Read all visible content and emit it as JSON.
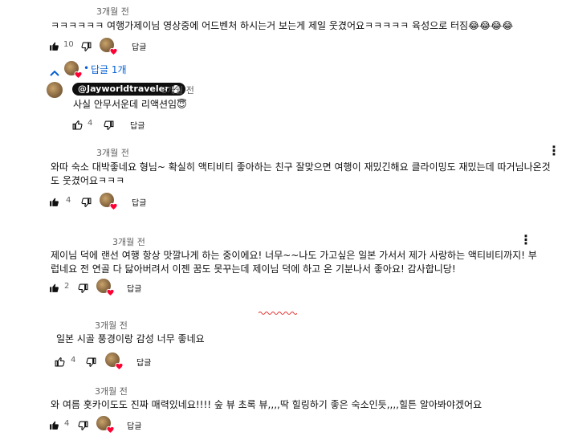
{
  "comments": [
    {
      "time": "3개월 전",
      "text": "ㅋㅋㅋㅋㅋㅋ 여행가제이님 영상중에 어드벤처 하시는거 보는게 제일 웃겼어요ㅋㅋㅋㅋㅋ 육성으로 터짐😂😂😂😂",
      "likes": "10",
      "reply_label": "답글"
    },
    {
      "time": "3개월 전",
      "text": "와따 숙소 대박좋네요 형님~ 확실히 액티비티 좋아하는 친구 잘맞으면 여행이 재밌긴해요 클라이밍도 재밌는데 따거님나온것도 웃겼어요ㅋㅋㅋ",
      "likes": "4",
      "reply_label": "답글"
    },
    {
      "time": "3개월 전",
      "text": "제이님 덕에 랜선 여행 항상 맛깔나게 하는 중이에요! 너무~~나도 가고싶은 일본 가서서 제가 사랑하는 액티비티까지! 부럽네요 전 연골 다 닳아버려서 이젠 꿈도 못꾸는데 제이님 덕에 하고 온 기분나서 좋아요! 감사합니당!",
      "likes": "2",
      "reply_label": "답글"
    },
    {
      "time": "3개월 전",
      "text": "일본 시골 풍경이랑 감성 너무 좋네요",
      "likes": "4",
      "reply_label": "답글"
    },
    {
      "time": "3개월 전",
      "text": "와 여름 홋카이도도 진짜 매력있네요!!!! 숲 뷰 초록 뷰,,,,딱 힐링하기 좋은 숙소인듯,,,,힐튼 알아봐야겠어요",
      "likes": "4",
      "reply_label": "답글"
    }
  ],
  "reply_thread": {
    "toggle_label": "답글 1개",
    "author": "@Jayworldtraveler",
    "time": "3개월 전",
    "text": "사실 안무서운데 리액션임😇",
    "likes": "4",
    "reply_label": "답글"
  },
  "colors": {
    "link_blue": "#065fd4",
    "heart_red": "#ff0033",
    "muted_text": "#606060"
  },
  "icons": [
    "thumbs-up-icon",
    "thumbs-down-icon",
    "heart-icon",
    "chevron-up-icon",
    "more-vert-icon",
    "verified-check-icon"
  ]
}
